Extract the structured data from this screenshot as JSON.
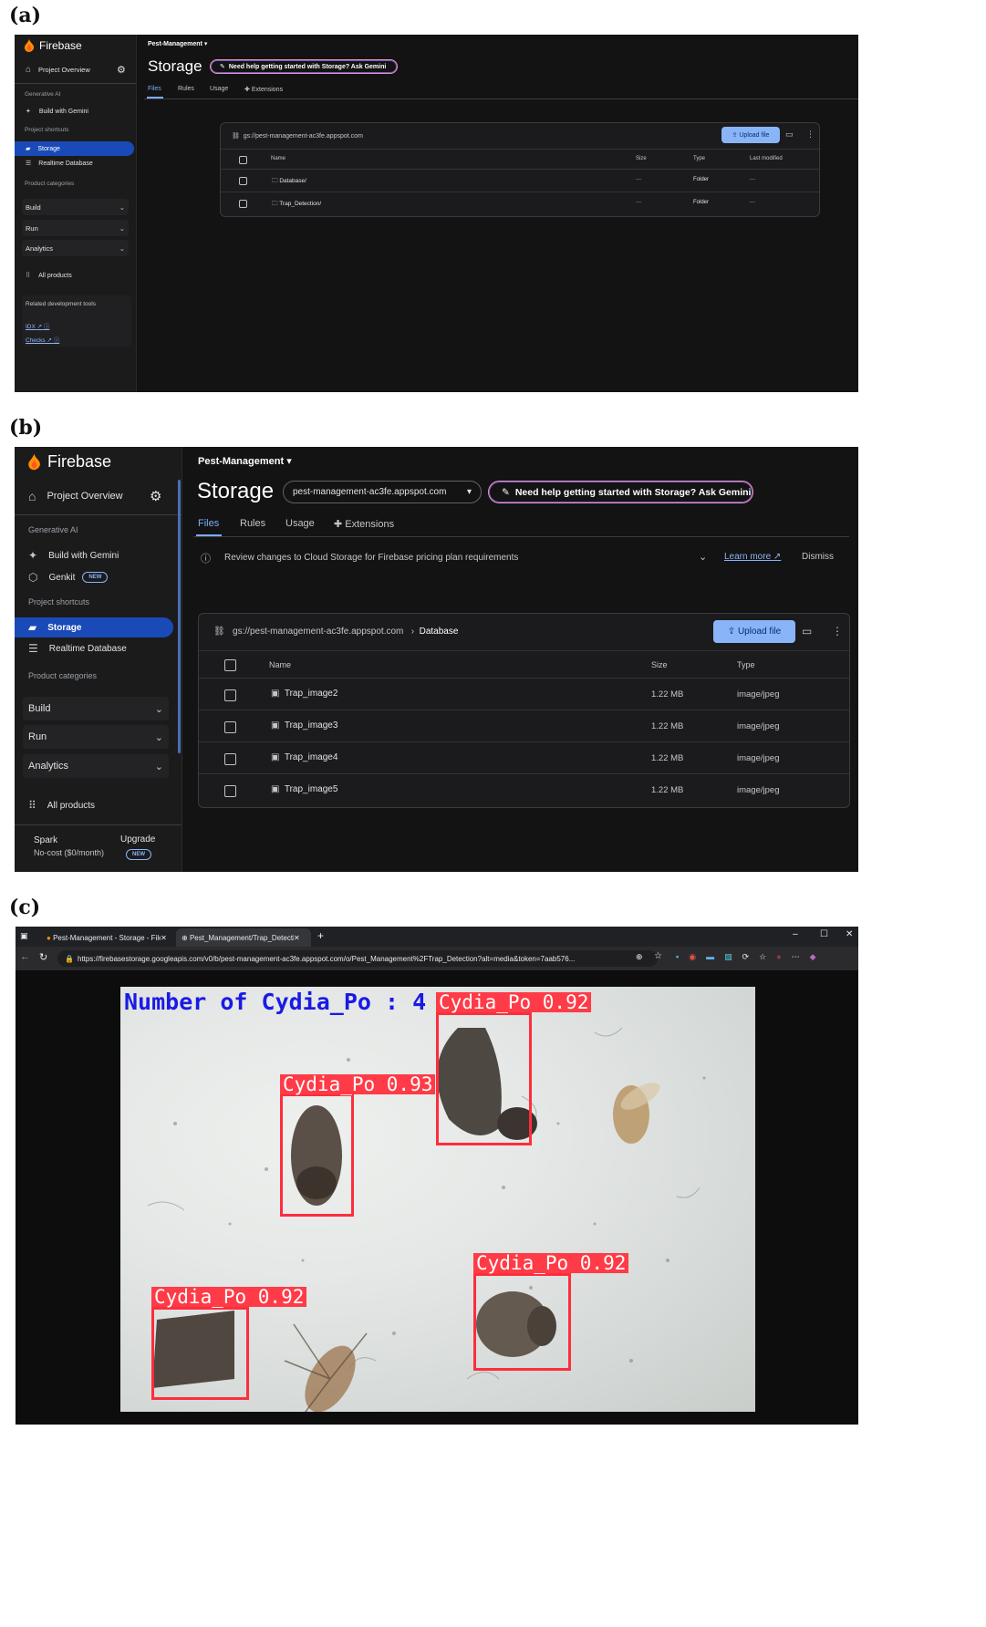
{
  "labels": {
    "a": "(a)",
    "b": "(b)",
    "c": "(c)"
  },
  "panel_a": {
    "logo": "Firebase",
    "project_overview": "Project Overview",
    "section_genai": "Generative AI",
    "build_with_gemini": "Build with Gemini",
    "section_shortcuts": "Project shortcuts",
    "storage": "Storage",
    "realtime_db": "Realtime Database",
    "section_categories": "Product categories",
    "build": "Build",
    "run": "Run",
    "analytics": "Analytics",
    "all_products": "All products",
    "related_tools": "Related development tools",
    "idx": "IDX",
    "checks": "Checks",
    "project_name": "Pest-Management",
    "page_title": "Storage",
    "gemini_pill": "Need help getting started with Storage? Ask Gemini",
    "tabs": [
      "Files",
      "Rules",
      "Usage",
      "Extensions"
    ],
    "bucket": "gs://pest-management-ac3fe.appspot.com",
    "upload": "Upload file",
    "columns": [
      "Name",
      "Size",
      "Type",
      "Last modified"
    ],
    "rows": [
      {
        "name": "Database/",
        "size": "—",
        "type": "Folder",
        "modified": "—"
      },
      {
        "name": "Trap_Detection/",
        "size": "—",
        "type": "Folder",
        "modified": "—"
      }
    ]
  },
  "panel_b": {
    "logo": "Firebase",
    "project_overview": "Project Overview",
    "section_genai": "Generative AI",
    "build_with_gemini": "Build with Gemini",
    "genkit": "Genkit",
    "new_badge": "NEW",
    "section_shortcuts": "Project shortcuts",
    "storage": "Storage",
    "realtime_db": "Realtime Database",
    "section_categories": "Product categories",
    "build": "Build",
    "run": "Run",
    "analytics": "Analytics",
    "all_products": "All products",
    "plan": "Spark",
    "plan_cost": "No-cost ($0/month)",
    "upgrade": "Upgrade",
    "project_name": "Pest-Management",
    "page_title": "Storage",
    "bucket_select": "pest-management-ac3fe.appspot.com",
    "gemini_pill": "Need help getting started with Storage? Ask Gemini",
    "tabs": [
      "Files",
      "Rules",
      "Usage",
      "Extensions"
    ],
    "banner_text": "Review changes to Cloud Storage for Firebase pricing plan requirements",
    "learn_more": "Learn more",
    "dismiss": "Dismiss",
    "bucket": "gs://pest-management-ac3fe.appspot.com",
    "crumb": "Database",
    "upload": "Upload file",
    "columns": [
      "Name",
      "Size",
      "Type"
    ],
    "rows": [
      {
        "name": "Trap_image2",
        "size": "1.22 MB",
        "type": "image/jpeg"
      },
      {
        "name": "Trap_image3",
        "size": "1.22 MB",
        "type": "image/jpeg"
      },
      {
        "name": "Trap_image4",
        "size": "1.22 MB",
        "type": "image/jpeg"
      },
      {
        "name": "Trap_image5",
        "size": "1.22 MB",
        "type": "image/jpeg"
      }
    ]
  },
  "panel_c": {
    "tab1": "Pest-Management - Storage - File",
    "tab2": "Pest_Management/Trap_Detection",
    "url": "https://firebasestorage.googleapis.com/v0/b/pest-management-ac3fe.appspot.com/o/Pest_Management%2FTrap_Detection?alt=media&token=7aab576...",
    "count_text": "Number of Cydia_Po : 4",
    "detections": [
      "Cydia_Po 0.92",
      "Cydia_Po 0.93",
      "Cydia_Po 0.92",
      "Cydia_Po 0.92"
    ]
  }
}
